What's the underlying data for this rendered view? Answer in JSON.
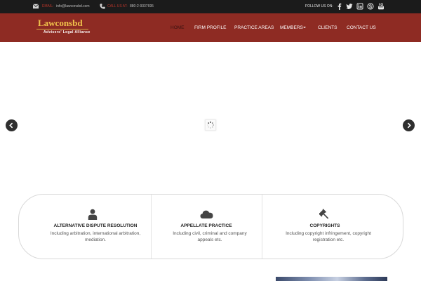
{
  "topbar": {
    "email_label": "EMAIL:",
    "email_value": "info@lawconsbd.com",
    "phone_label": "CALL US AT:",
    "phone_value": "880-2-9337695",
    "follow_label": "FOLLOW US ON:",
    "social_icons": [
      "facebook-icon",
      "twitter-icon",
      "linkedin-icon",
      "skype-icon",
      "youtube-icon"
    ]
  },
  "logo": {
    "title": "Lawconsbd",
    "subtitle": "Advisers' Legal Alliance"
  },
  "nav": {
    "items": [
      "HOME",
      "FIRM PROFILE",
      "PRACTICE AREAS",
      "MEMBERS",
      "CLIENTS",
      "CONTACT US"
    ],
    "active": "HOME"
  },
  "services": [
    {
      "icon": "user-icon",
      "title": "ALTERNATIVE DISPUTE RESOLUTION",
      "desc_line1": "Including arbitration, international arbitration,",
      "desc_line2": "mediation."
    },
    {
      "icon": "cloud-icon",
      "title": "APPELLATE PRACTICE",
      "desc_line1": "Including civil, criminal and company",
      "desc_line2": "appeals etc."
    },
    {
      "icon": "gavel-icon",
      "title": "COPYRIGHTS",
      "desc_line1": "Including copyright infringement, copyright",
      "desc_line2": "registration etc."
    }
  ],
  "colors": {
    "topbar_bg": "#1b1b1b",
    "nav_bg": "#8e2b23",
    "accent_red": "#b5352a",
    "logo_gold": "#f0c24b"
  }
}
